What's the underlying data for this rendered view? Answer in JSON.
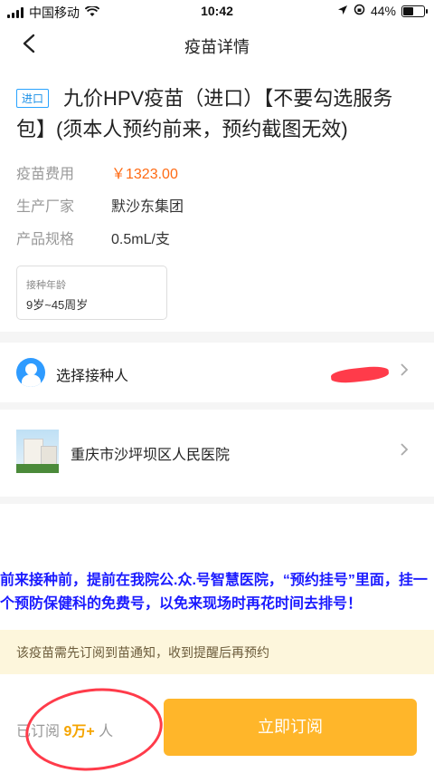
{
  "status_bar": {
    "carrier": "中国移动",
    "time": "10:42",
    "battery": "44%"
  },
  "nav": {
    "title": "疫苗详情"
  },
  "vaccine": {
    "tag": "进口",
    "name": "九价HPV疫苗（进口）【不要勾选服务包】(须本人预约前来，预约截图无效)",
    "fee_label": "疫苗费用",
    "fee_value": "￥1323.00",
    "maker_label": "生产厂家",
    "maker_value": "默沙东集团",
    "spec_label": "产品规格",
    "spec_value": "0.5mL/支",
    "age_label": "接种年龄",
    "age_value": "9岁~45周岁"
  },
  "recipient": {
    "label": "选择接种人"
  },
  "hospital": {
    "name": "重庆市沙坪坝区人民医院"
  },
  "notice": {
    "text": "前来接种前，提前在我院公.众.号智慧医院，“预约挂号”里面，挂一个预防保健科的免费号，以免来现场时再花时间去排号！"
  },
  "tip": {
    "text": "该疫苗需先订阅到苗通知，收到提醒后再预约"
  },
  "bottom": {
    "subscribed_prefix": "已订阅",
    "subscribed_count": "9万+",
    "subscribed_suffix": "人",
    "subscribe_button": "立即订阅"
  },
  "colors": {
    "price": "#ff6a13",
    "accent_button": "#ffb62a",
    "notice_text": "#1a1aff",
    "annotation_red": "#ff3b4a"
  }
}
